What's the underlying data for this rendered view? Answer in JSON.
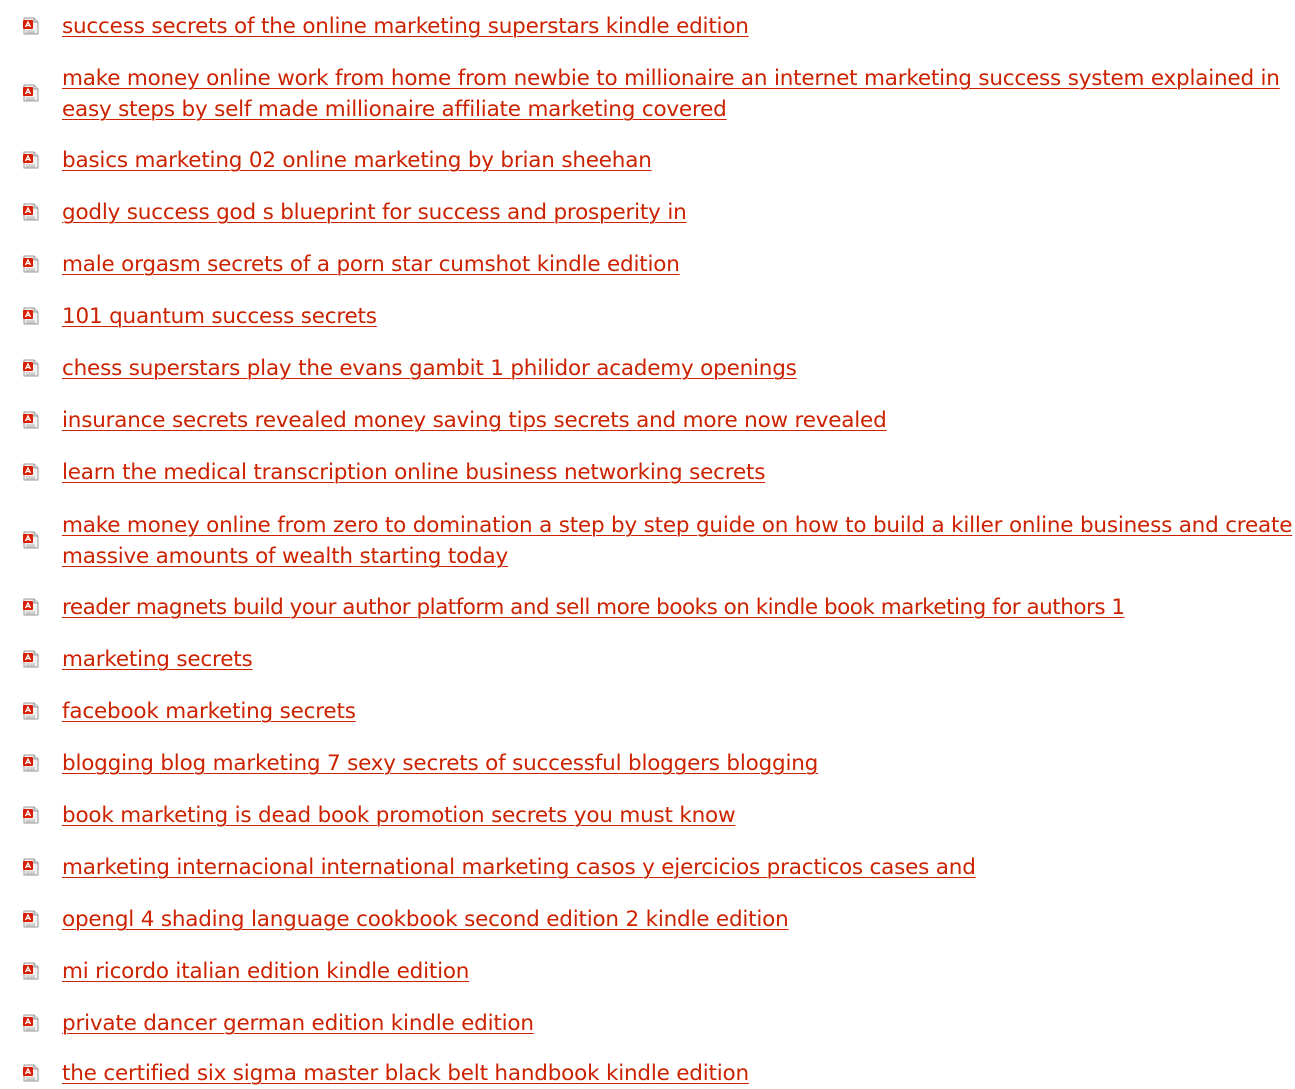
{
  "links": [
    {
      "label": "success secrets of the online marketing superstars kindle edition"
    },
    {
      "label": "make money online work from home from newbie to millionaire an internet marketing success system explained in easy steps by self made millionaire affiliate marketing covered"
    },
    {
      "label": "basics marketing 02 online marketing by brian sheehan"
    },
    {
      "label": "godly success god s blueprint for success and prosperity in"
    },
    {
      "label": "male orgasm secrets of a porn star cumshot kindle edition"
    },
    {
      "label": "101 quantum success secrets"
    },
    {
      "label": "chess superstars play the evans gambit 1 philidor academy openings"
    },
    {
      "label": "insurance secrets revealed money saving tips secrets and more now revealed"
    },
    {
      "label": "learn the medical transcription online business networking secrets"
    },
    {
      "label": "make money online from zero to domination a step by step guide on how to build a killer online business and create massive amounts of wealth starting today"
    },
    {
      "label": "reader magnets build your author platform and sell more books on kindle book marketing for authors 1"
    },
    {
      "label": "marketing secrets"
    },
    {
      "label": "facebook marketing secrets"
    },
    {
      "label": "blogging blog marketing 7 sexy secrets of successful bloggers blogging"
    },
    {
      "label": "book marketing is dead book promotion secrets you must know"
    },
    {
      "label": "marketing internacional international marketing casos y ejercicios practicos cases and"
    },
    {
      "label": "opengl 4 shading language cookbook second edition 2 kindle edition"
    },
    {
      "label": "mi ricordo italian edition kindle edition"
    },
    {
      "label": "private dancer german edition kindle edition"
    },
    {
      "label": "the certified six sigma master black belt handbook kindle edition"
    }
  ],
  "icon": "pdf-file-icon",
  "colors": {
    "link": "#cc2200",
    "icon_red": "#d81e05",
    "background": "#ffffff"
  }
}
